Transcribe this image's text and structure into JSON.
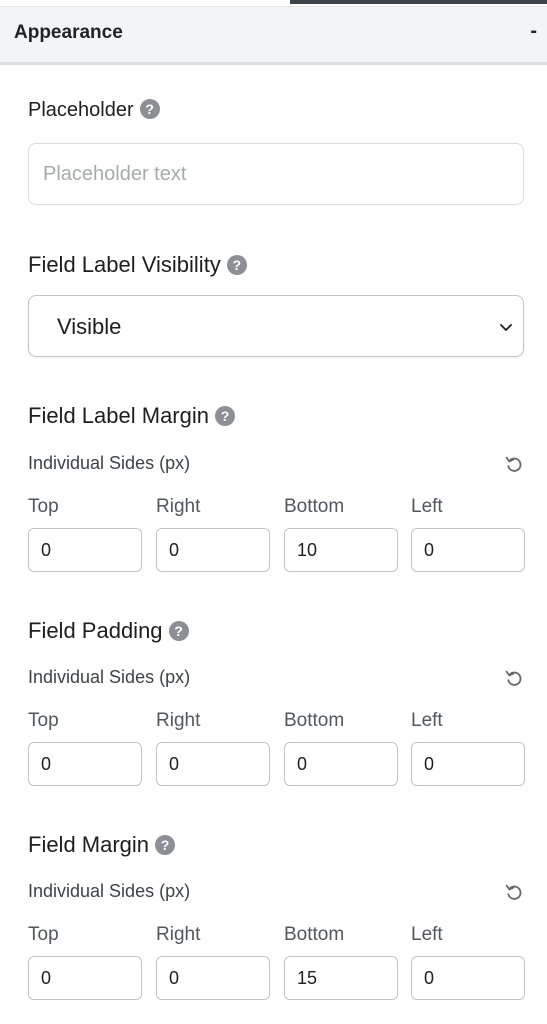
{
  "panel": {
    "title": "Appearance",
    "collapse_symbol": "-"
  },
  "placeholder": {
    "label": "Placeholder",
    "help_icon": "?",
    "input_placeholder": "Placeholder text",
    "value": ""
  },
  "field_label_visibility": {
    "label": "Field Label Visibility",
    "help_icon": "?",
    "selected": "Visible"
  },
  "field_label_margin": {
    "label": "Field Label Margin",
    "help_icon": "?",
    "sub_label": "Individual Sides (px)",
    "sides": [
      "Top",
      "Right",
      "Bottom",
      "Left"
    ],
    "values": [
      "0",
      "0",
      "10",
      "0"
    ]
  },
  "field_padding": {
    "label": "Field Padding",
    "help_icon": "?",
    "sub_label": "Individual Sides (px)",
    "sides": [
      "Top",
      "Right",
      "Bottom",
      "Left"
    ],
    "values": [
      "0",
      "0",
      "0",
      "0"
    ]
  },
  "field_margin": {
    "label": "Field Margin",
    "help_icon": "?",
    "sub_label": "Individual Sides (px)",
    "sides": [
      "Top",
      "Right",
      "Bottom",
      "Left"
    ],
    "values": [
      "0",
      "0",
      "15",
      "0"
    ]
  },
  "icons": {
    "help": "question-circle-icon",
    "reset": "reset-icon",
    "dropdown": "chevron-down-icon"
  },
  "colors": {
    "header_bg": "#f3f4f6",
    "help_icon_bg": "#8c8f94",
    "accent_bar": "#3c434a"
  }
}
